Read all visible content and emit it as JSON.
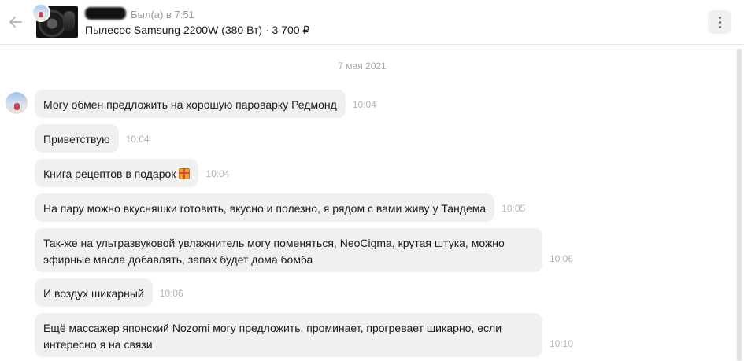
{
  "header": {
    "status": "Был(а) в 7:51",
    "product": "Пылесос Samsung 2200W (380 Вт) · 3 700 ₽"
  },
  "chat": {
    "date": "7 мая 2021",
    "messages": [
      {
        "text": "Могу обмен предложить на хорошую пароварку Редмонд",
        "time": "10:04"
      },
      {
        "text": "Приветствую",
        "time": "10:04"
      },
      {
        "text": "Книга рецептов в подарок",
        "time": "10:04",
        "emoji": "gift-icon"
      },
      {
        "text": "На пару можно вкусняшки готовить, вкусно и полезно, я рядом с вами живу у Тандема",
        "time": "10:05"
      },
      {
        "text": "Так-же на ультразвуковой увлажнитель могу поменяться, NeoCigma, крутая штука, можно эфирные масла добавлять, запах будет дома бомба",
        "time": "10:06"
      },
      {
        "text": "И воздух шикарный",
        "time": "10:06"
      },
      {
        "text": "Ещё массажер японский Nozomi могу предложить, проминает, прогревает шикарно, если интересно я на связи",
        "time": "10:10"
      }
    ]
  },
  "icons": {
    "back": "arrow-left-icon",
    "menu": "more-vertical-icon"
  },
  "colors": {
    "bubble": "#f0f0f0",
    "time": "#b3b3b3",
    "background": "#ffffff"
  }
}
